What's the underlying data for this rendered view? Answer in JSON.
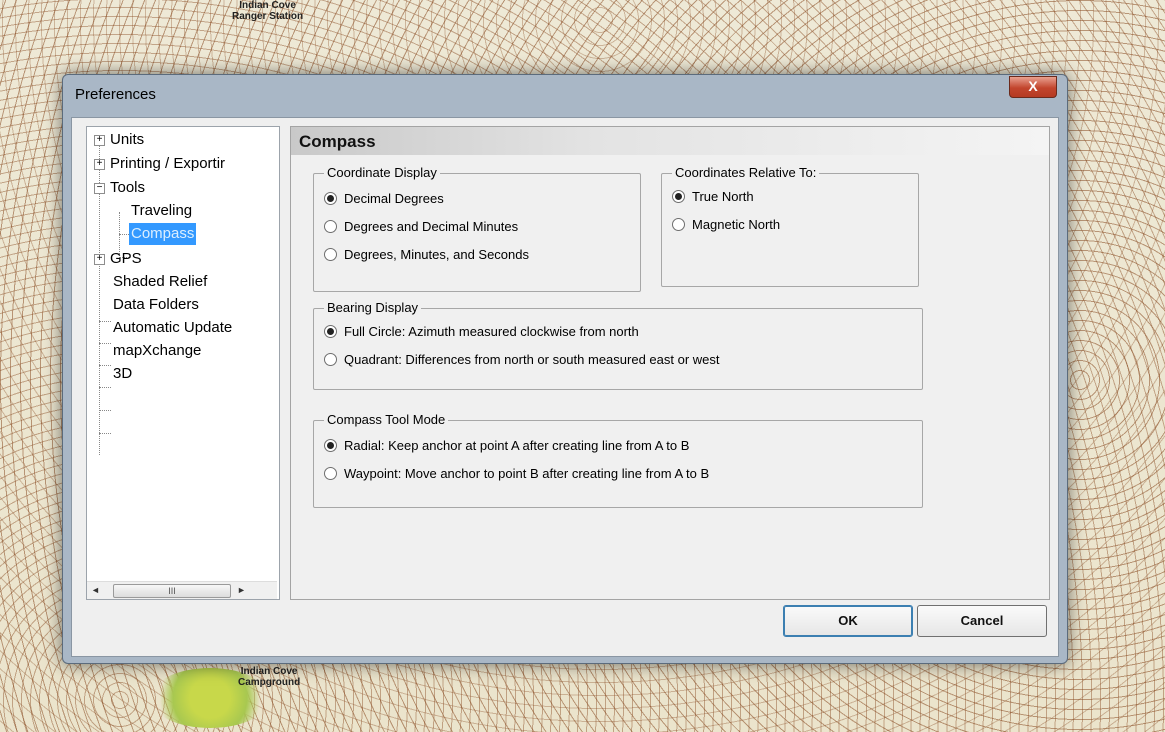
{
  "map": {
    "labels": [
      "Indian Cove\nRanger Station",
      "Indian Cove\nCampground"
    ]
  },
  "window": {
    "title": "Preferences",
    "close_label": "X"
  },
  "tree": {
    "items": [
      {
        "label": "Units",
        "expander": "+"
      },
      {
        "label": "Printing / Exportir",
        "expander": "+"
      },
      {
        "label": "Tools",
        "expander": "−"
      },
      {
        "label": "Traveling",
        "expander": ""
      },
      {
        "label": "Compass",
        "expander": ""
      },
      {
        "label": "GPS",
        "expander": "+"
      },
      {
        "label": "Shaded Relief",
        "expander": ""
      },
      {
        "label": "Data Folders",
        "expander": ""
      },
      {
        "label": "Automatic Update",
        "expander": ""
      },
      {
        "label": "mapXchange",
        "expander": ""
      },
      {
        "label": "3D",
        "expander": ""
      }
    ],
    "scroll": {
      "left": "◄",
      "right": "►",
      "thumb": "III"
    }
  },
  "panel": {
    "title": "Compass",
    "coordinate_display": {
      "label": "Coordinate Display",
      "options": [
        "Decimal Degrees",
        "Degrees and Decimal Minutes",
        "Degrees, Minutes, and Seconds"
      ],
      "selected": 0
    },
    "coordinates_relative": {
      "label": "Coordinates Relative To:",
      "options": [
        "True North",
        "Magnetic North"
      ],
      "selected": 0
    },
    "bearing_display": {
      "label": "Bearing Display",
      "options": [
        "Full Circle: Azimuth measured clockwise from north",
        "Quadrant: Differences from north or south measured east or west"
      ],
      "selected": 0
    },
    "compass_tool_mode": {
      "label": "Compass Tool Mode",
      "options": [
        "Radial: Keep anchor at point A after creating line from A to B",
        "Waypoint: Move anchor to point B after creating line from A to B"
      ],
      "selected": 0
    }
  },
  "buttons": {
    "ok": "OK",
    "cancel": "Cancel"
  }
}
